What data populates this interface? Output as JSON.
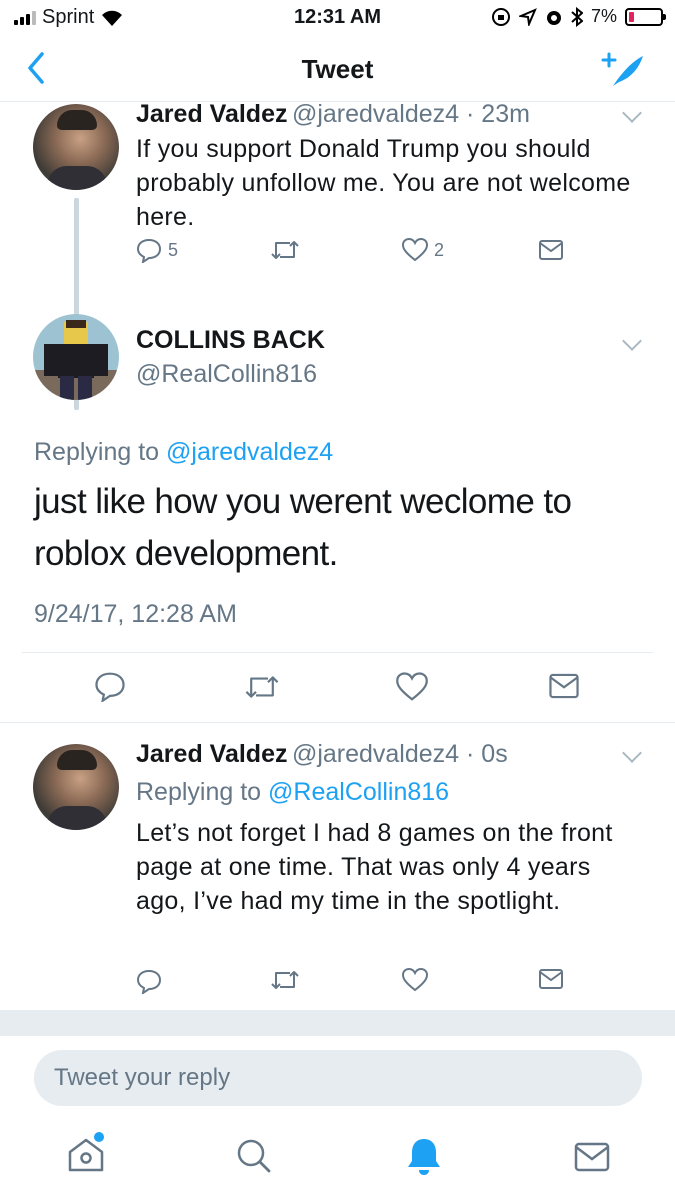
{
  "status_bar": {
    "carrier": "Sprint",
    "time": "12:31 AM",
    "battery": "7%"
  },
  "nav": {
    "title": "Tweet"
  },
  "tweets": [
    {
      "name": "Jared Valdez",
      "handle": "@jaredvaldez4",
      "time": "23m",
      "text": "If you support Donald Trump you should probably unfollow me. You are not welcome here.",
      "reply_count": "5",
      "like_count": "2"
    },
    {
      "name": "COLLINS BACK",
      "handle": "@RealCollin816",
      "replying_prefix": "Replying to",
      "replying_to": "@jaredvaldez4",
      "text": "just like how you werent weclome to roblox development.",
      "timestamp": "9/24/17, 12:28 AM"
    },
    {
      "name": "Jared Valdez",
      "handle": "@jaredvaldez4",
      "time": "0s",
      "replying_prefix": "Replying to",
      "replying_to": "@RealCollin816",
      "text": "Let’s not forget I had 8 games on the front page at one time. That was only 4 years ago, I’ve had my time in the spotlight."
    }
  ],
  "reply_input": {
    "placeholder": "Tweet your reply"
  },
  "colors": {
    "accent": "#1da1f2",
    "gray": "#657786",
    "divider": "#e6ecf0"
  },
  "tab_bar": {
    "icons": [
      "home-icon",
      "search-icon",
      "notifications-icon",
      "messages-icon"
    ],
    "active": "notifications-icon"
  }
}
